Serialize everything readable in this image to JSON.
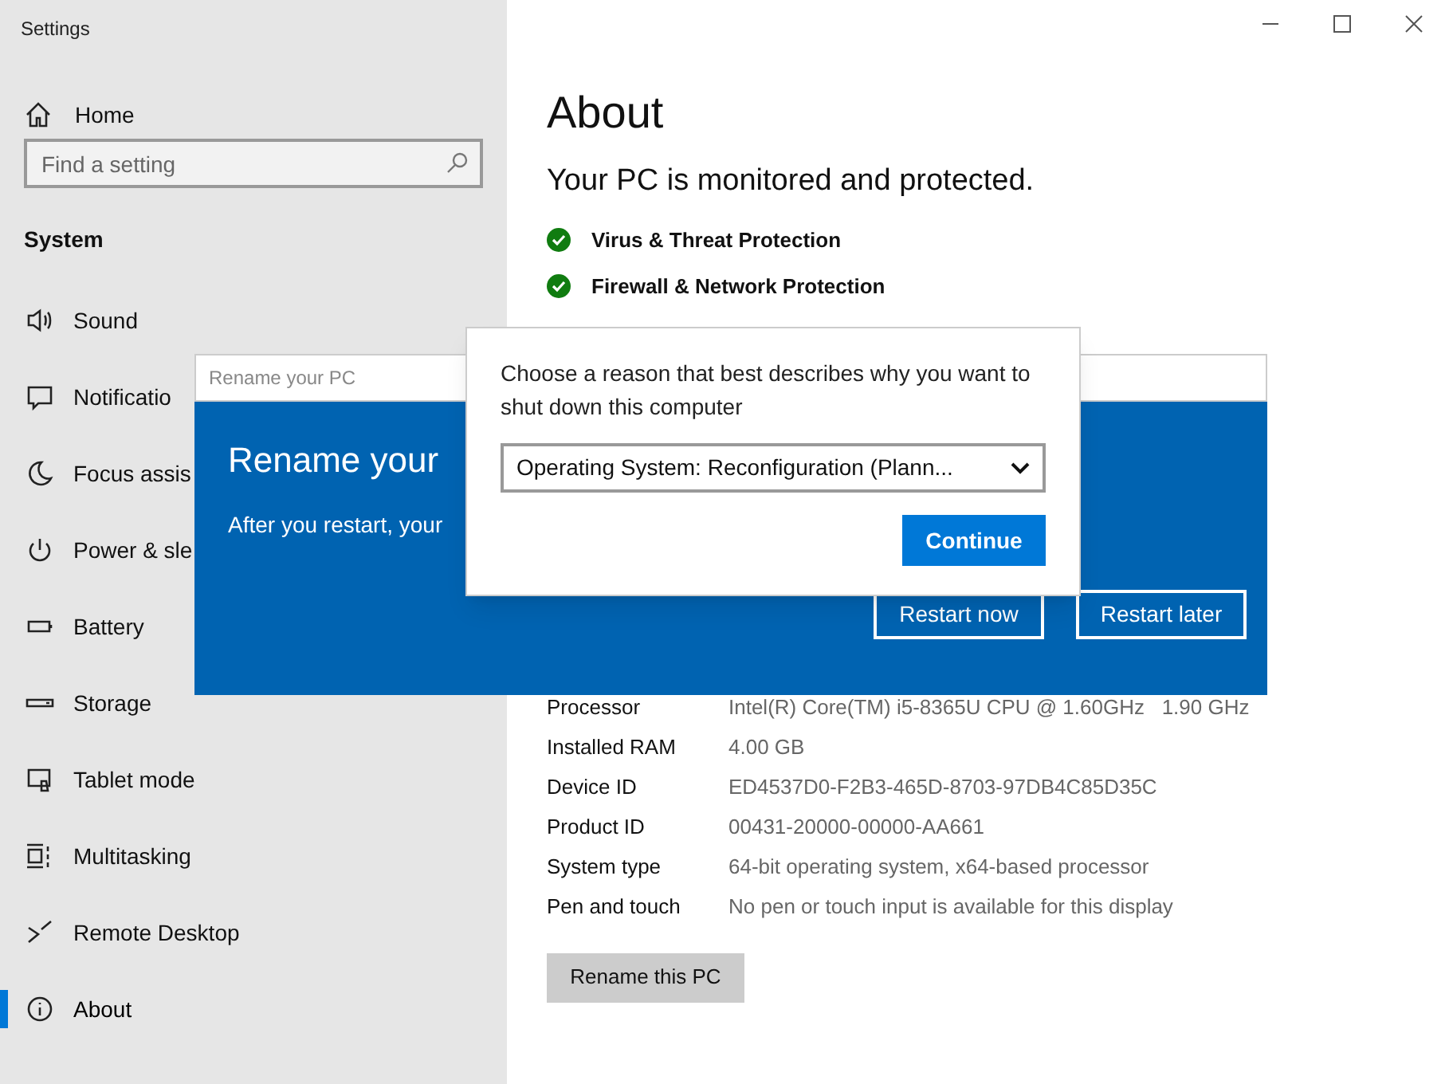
{
  "window": {
    "title": "Settings"
  },
  "sidebar": {
    "home": "Home",
    "search": {
      "placeholder": "Find a setting"
    },
    "section": "System",
    "items": [
      {
        "label": "Sound",
        "selected": false
      },
      {
        "label": "Notificatio",
        "selected": false
      },
      {
        "label": "Focus assis",
        "selected": false
      },
      {
        "label": "Power & sle",
        "selected": false
      },
      {
        "label": "Battery",
        "selected": false
      },
      {
        "label": "Storage",
        "selected": false
      },
      {
        "label": "Tablet mode",
        "selected": false
      },
      {
        "label": "Multitasking",
        "selected": false
      },
      {
        "label": "Remote Desktop",
        "selected": false
      },
      {
        "label": "About",
        "selected": true
      }
    ]
  },
  "main": {
    "title": "About",
    "status": "Your PC is monitored and protected.",
    "protections": [
      {
        "label": "Virus & Threat Protection",
        "color": "#107c10"
      },
      {
        "label": "Firewall & Network Protection",
        "color": "#107c10"
      }
    ],
    "specs": [
      {
        "label": "Processor",
        "value": "Intel(R) Core(TM) i5-8365U CPU @ 1.60GHz   1.90 GHz"
      },
      {
        "label": "Installed RAM",
        "value": "4.00 GB"
      },
      {
        "label": "Device ID",
        "value": "ED4537D0-F2B3-465D-8703-97DB4C85D35C"
      },
      {
        "label": "Product ID",
        "value": "00431-20000-00000-AA661"
      },
      {
        "label": "System type",
        "value": "64-bit operating system, x64-based processor"
      },
      {
        "label": "Pen and touch",
        "value": "No pen or touch input is available for this display"
      }
    ],
    "rename_button": "Rename this PC"
  },
  "rename_dialog": {
    "title": "Rename your PC",
    "heading": "Rename your",
    "text": "After you restart, your",
    "buttons": [
      "Restart now",
      "Restart later"
    ]
  },
  "shutdown_dialog": {
    "prompt": "Choose a reason that best describes why you want to shut down this computer",
    "reason": "Operating System: Reconfiguration (Plann...",
    "button": "Continue"
  }
}
